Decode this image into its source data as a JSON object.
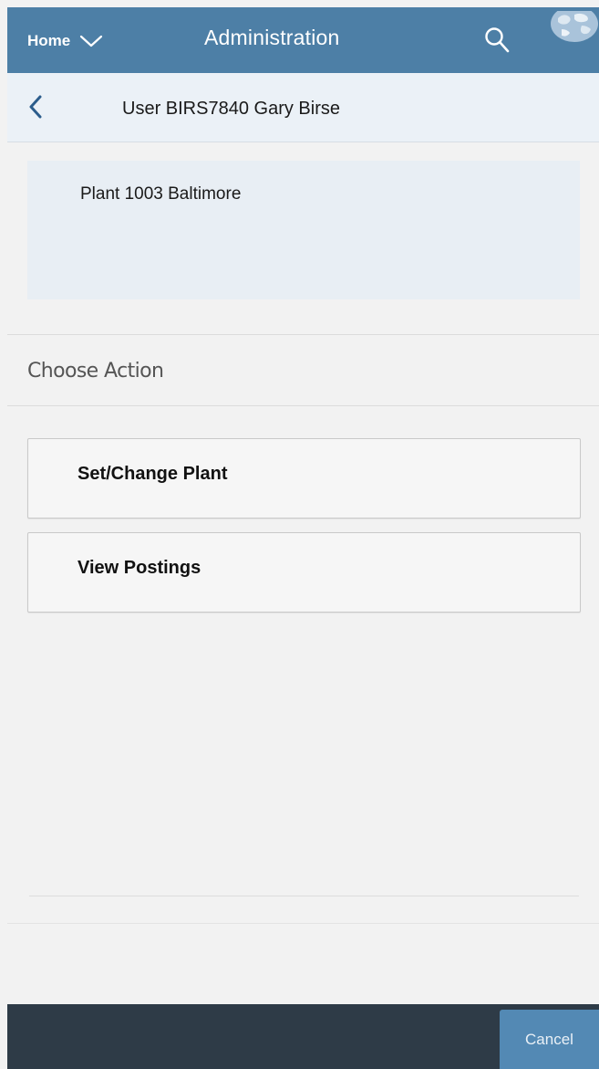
{
  "header": {
    "home_label": "Home",
    "title": "Administration",
    "icons": {
      "home_menu": "chevron-down-icon",
      "search": "search-icon",
      "globe": "globe-icon"
    }
  },
  "subheader": {
    "back_icon": "chevron-left-icon",
    "title": "User BIRS7840 Gary Birse"
  },
  "info": {
    "plant": "Plant 1003 Baltimore"
  },
  "actions": {
    "section_label": "Choose Action",
    "items": [
      {
        "label": "Set/Change Plant"
      },
      {
        "label": "View Postings"
      }
    ]
  },
  "footer": {
    "cancel_label": "Cancel"
  },
  "colors": {
    "header_bg": "#4d7fa6",
    "subheader_bg": "#ebf1f7",
    "footer_bg": "#2e3b47",
    "cancel_bg": "#5389b4"
  }
}
